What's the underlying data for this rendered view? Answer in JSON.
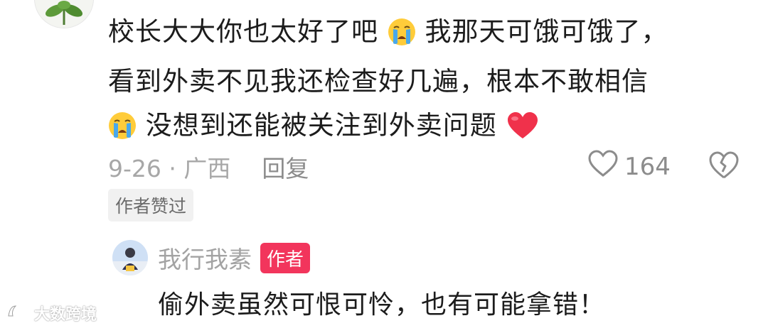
{
  "comment": {
    "line1_a": "校长大大你也太好了吧",
    "line1_b": "我那天可饿可饿了，",
    "line2": "看到外卖不见我还检查好几遍，根本不敢相信",
    "line3": "没想到还能被关注到外卖问题",
    "emoji_1": "crying-face-emoji",
    "emoji_2": "crying-face-emoji",
    "emoji_3": "red-heart-emoji",
    "date_location": "9-26 · 广西",
    "reply_label": "回复",
    "like_count": "164",
    "author_liked_badge": "作者赞过"
  },
  "reply": {
    "username": "我行我素",
    "author_tag": "作者",
    "text": "偷外卖虽然可恨可怜，也有可能拿错！"
  },
  "watermark": {
    "text": "大数跨境"
  },
  "colors": {
    "author_tag": "#f2355c",
    "muted_text": "#a7a7a7",
    "heart": "#f0314b"
  }
}
